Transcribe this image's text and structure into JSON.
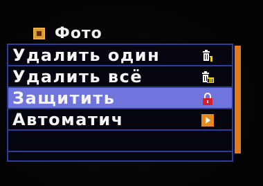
{
  "header": {
    "title": "Фото",
    "icon": "photo-icon"
  },
  "menu": {
    "items": [
      {
        "label": "Удалить один",
        "icon": "trash-one-icon",
        "selected": false
      },
      {
        "label": "Удалить всё",
        "icon": "trash-all-icon",
        "selected": false
      },
      {
        "label": "Защитить",
        "icon": "lock-icon",
        "selected": true
      },
      {
        "label": "Автоматич",
        "icon": "play-arrow-icon",
        "selected": false
      }
    ]
  },
  "colors": {
    "selection": "#6f75dc",
    "border": "#2b3e9e",
    "scrollbar": "#e07a1e",
    "accent_yellow": "#e8d21c",
    "lock_red": "#d81e2a"
  }
}
